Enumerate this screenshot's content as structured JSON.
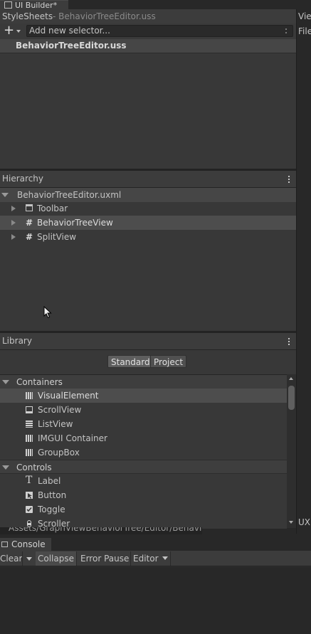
{
  "window": {
    "tab_title": "UI Builder*",
    "right_tab_title": "Vie",
    "right_tab_title2": "File",
    "right_bottom_label": "UX"
  },
  "stylesheets": {
    "title": "StyleSheets",
    "subtitle": "- BehaviorTreeEditor.uss",
    "add_selector_placeholder": "Add new selector...",
    "file_label": "BehaviorTreeEditor.uss"
  },
  "hierarchy": {
    "title": "Hierarchy",
    "root": "BehaviorTreeEditor.uxml",
    "items": [
      {
        "label": "Toolbar",
        "icon": "toolbar-icon"
      },
      {
        "label": "BehaviorTreeView",
        "icon": "hash-icon"
      },
      {
        "label": "SplitView",
        "icon": "hash-icon"
      }
    ]
  },
  "library": {
    "title": "Library",
    "tabs": [
      "Standard",
      "Project"
    ],
    "sections": [
      {
        "label": "Containers",
        "items": [
          "VisualElement",
          "ScrollView",
          "ListView",
          "IMGUI Container",
          "GroupBox"
        ]
      },
      {
        "label": "Controls",
        "items": [
          "Label",
          "Button",
          "Toggle",
          "Scroller"
        ]
      }
    ]
  },
  "path_bar": {
    "text": "Assets/GraphViewBehaviorTree/Editor/Behavio"
  },
  "console": {
    "tab_title": "Console",
    "toolbar": {
      "clear": "Clear",
      "collapse": "Collapse",
      "error_pause": "Error Pause",
      "editor": "Editor"
    }
  },
  "colors": {
    "selected_row": "#4d4d4d",
    "panel_bg": "#383838",
    "header_bg": "#3c3c3c"
  }
}
